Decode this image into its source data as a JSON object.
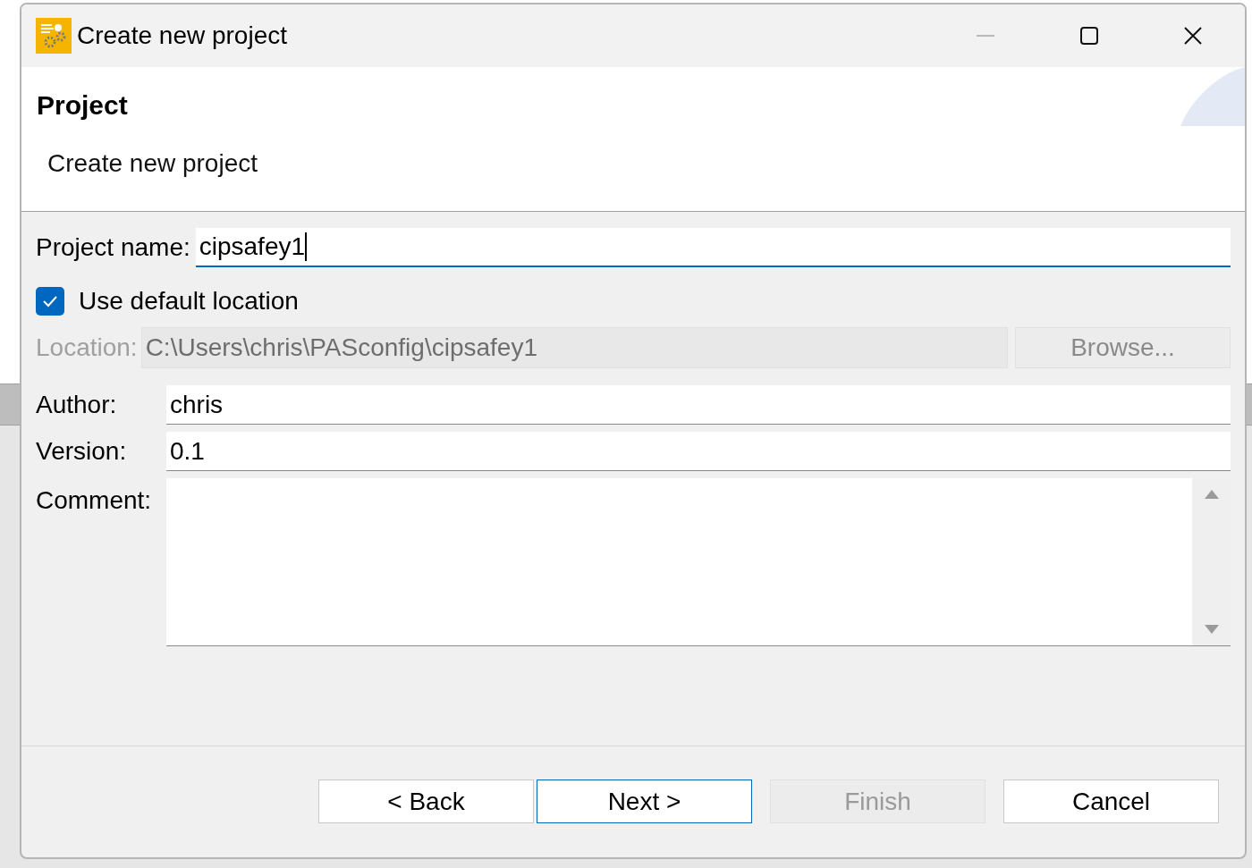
{
  "window": {
    "title": "Create new project"
  },
  "header": {
    "title": "Project",
    "description": "Create new project"
  },
  "form": {
    "project_name": {
      "label": "Project name:",
      "value": "cipsafey1",
      "focused": true
    },
    "use_default_location": {
      "label": "Use default location",
      "checked": true
    },
    "location": {
      "label": "Location:",
      "value": "C:\\Users\\chris\\PASconfig\\cipsafey1",
      "disabled": true
    },
    "browse_button": {
      "label": "Browse...",
      "disabled": true
    },
    "author": {
      "label": "Author:",
      "value": "chris"
    },
    "version": {
      "label": "Version:",
      "value": "0.1"
    },
    "comment": {
      "label": "Comment:"
    }
  },
  "buttons": [
    {
      "label": "< Back",
      "disabled": false,
      "default": false
    },
    {
      "label": "Next >",
      "disabled": false,
      "default": true
    },
    {
      "label": "Finish",
      "disabled": true,
      "default": false
    },
    {
      "label": "Cancel",
      "disabled": false,
      "default": false
    }
  ]
}
